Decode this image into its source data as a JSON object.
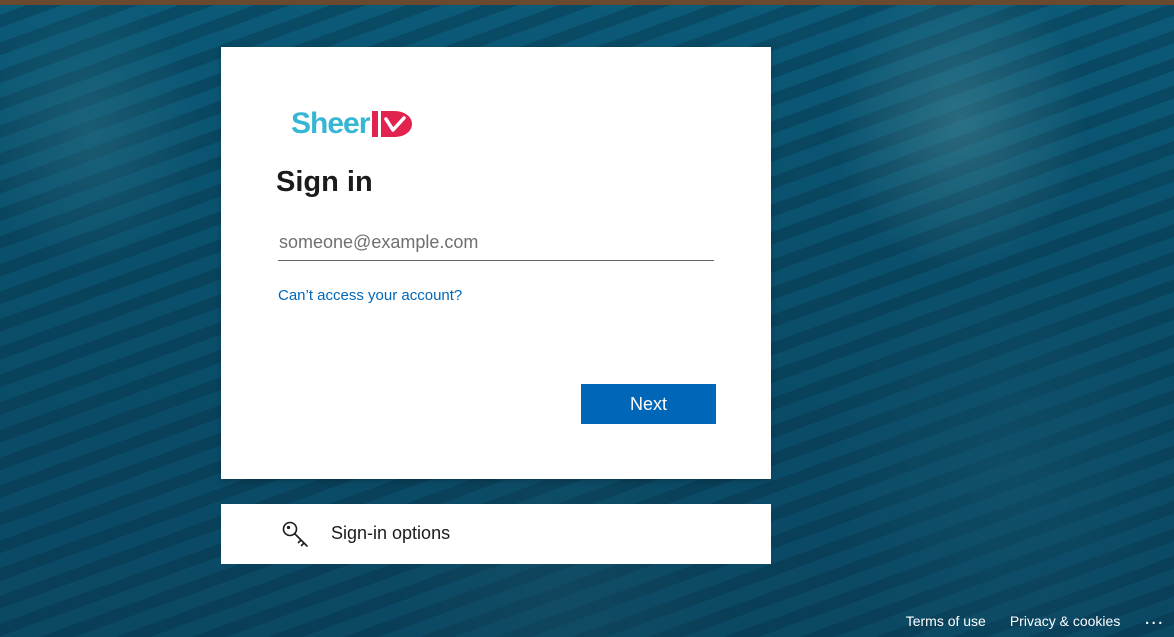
{
  "logo": {
    "text": "Sheer",
    "brand_colors": {
      "primary": "#35b7d3",
      "accent": "#e2234f"
    },
    "id_mark_text": "ID"
  },
  "signin": {
    "title": "Sign in",
    "email_placeholder": "someone@example.com",
    "email_value": "",
    "cant_access_link": "Can’t access your account?",
    "next_button": "Next"
  },
  "signin_options": {
    "icon": "key-icon",
    "label": "Sign-in options"
  },
  "footer": {
    "terms": "Terms of use",
    "privacy": "Privacy & cookies",
    "more": "..."
  },
  "colors": {
    "background": "#0b5a78",
    "top_strip": "#6a4a2e",
    "link": "#0067b8",
    "button": "#0067b8"
  }
}
